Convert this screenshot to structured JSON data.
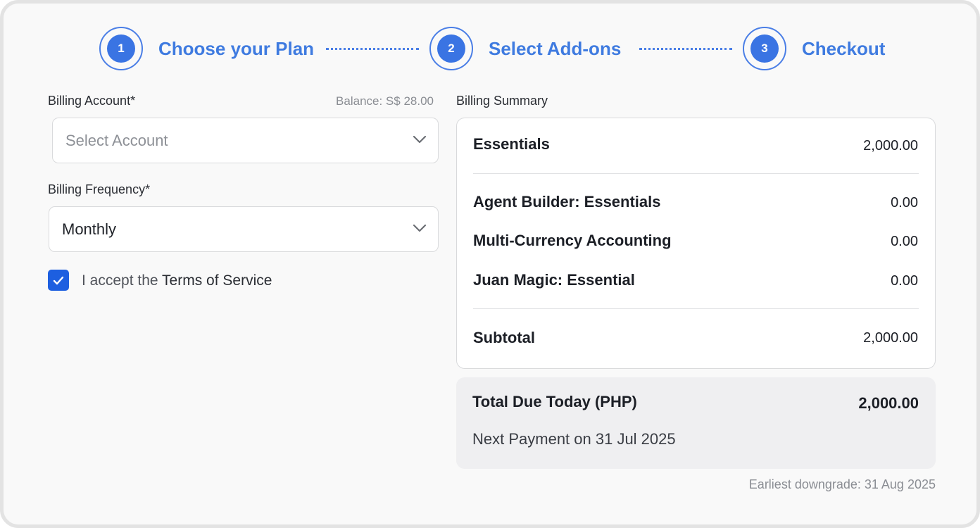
{
  "stepper": {
    "steps": [
      {
        "number": "1",
        "label": "Choose your Plan"
      },
      {
        "number": "2",
        "label": "Select Add-ons"
      },
      {
        "number": "3",
        "label": "Checkout"
      }
    ],
    "accent_color": "#3a74e3"
  },
  "billing_account": {
    "label": "Billing Account*",
    "balance": "Balance: S$ 28.00",
    "placeholder": "Select Account",
    "icon": "chevron-down-icon"
  },
  "billing_frequency": {
    "label": "Billing Frequency*",
    "value": "Monthly",
    "icon": "chevron-down-icon"
  },
  "terms": {
    "checked": true,
    "prefix": "I accept the",
    "link_text": "Terms of Service"
  },
  "summary": {
    "label": "Billing Summary",
    "plan": {
      "name": "Essentials",
      "amount": "2,000.00"
    },
    "addons": [
      {
        "name": "Agent Builder: Essentials",
        "amount": "0.00"
      },
      {
        "name": "Multi-Currency Accounting",
        "amount": "0.00"
      },
      {
        "name": "Juan Magic: Essential",
        "amount": "0.00"
      }
    ],
    "subtotal": {
      "name": "Subtotal",
      "amount": "2,000.00"
    }
  },
  "total": {
    "label": "Total Due Today (PHP)",
    "amount": "2,000.00",
    "next_payment": "Next Payment on 31 Jul 2025"
  },
  "earliest_downgrade": "Earliest downgrade: 31 Aug 2025"
}
